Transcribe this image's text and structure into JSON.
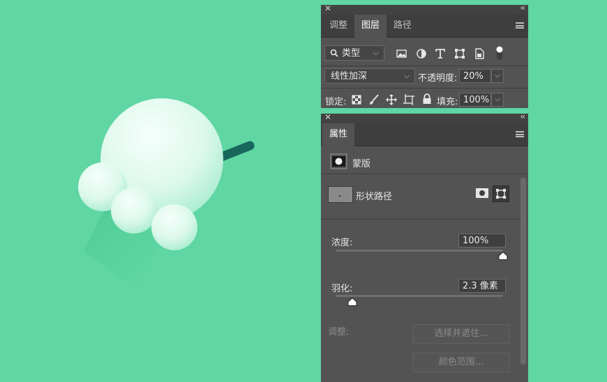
{
  "layers_panel": {
    "tabs": [
      "调整",
      "图层",
      "路径"
    ],
    "active_tab": "图层",
    "filter_select": "类型",
    "blend_mode": "线性加深",
    "opacity_label": "不透明度:",
    "opacity_value": "20%",
    "lock_label": "锁定:",
    "fill_label": "填充:",
    "fill_value": "100%"
  },
  "properties_panel": {
    "title": "属性",
    "mask_label": "蒙版",
    "shape_path_label": "形状路径",
    "density_label": "浓度:",
    "density_value": "100%",
    "density_level": 1.0,
    "feather_label": "羽化:",
    "feather_value": "2.3 像素",
    "feather_level": 0.1,
    "adjust_label": "调整:",
    "select_and_mask_button": "选择并遮住...",
    "color_range_button": "颜色范围..."
  },
  "colors": {
    "canvas_background": "#5fd6a3",
    "stick": "#17685a",
    "panel": "#535353"
  }
}
